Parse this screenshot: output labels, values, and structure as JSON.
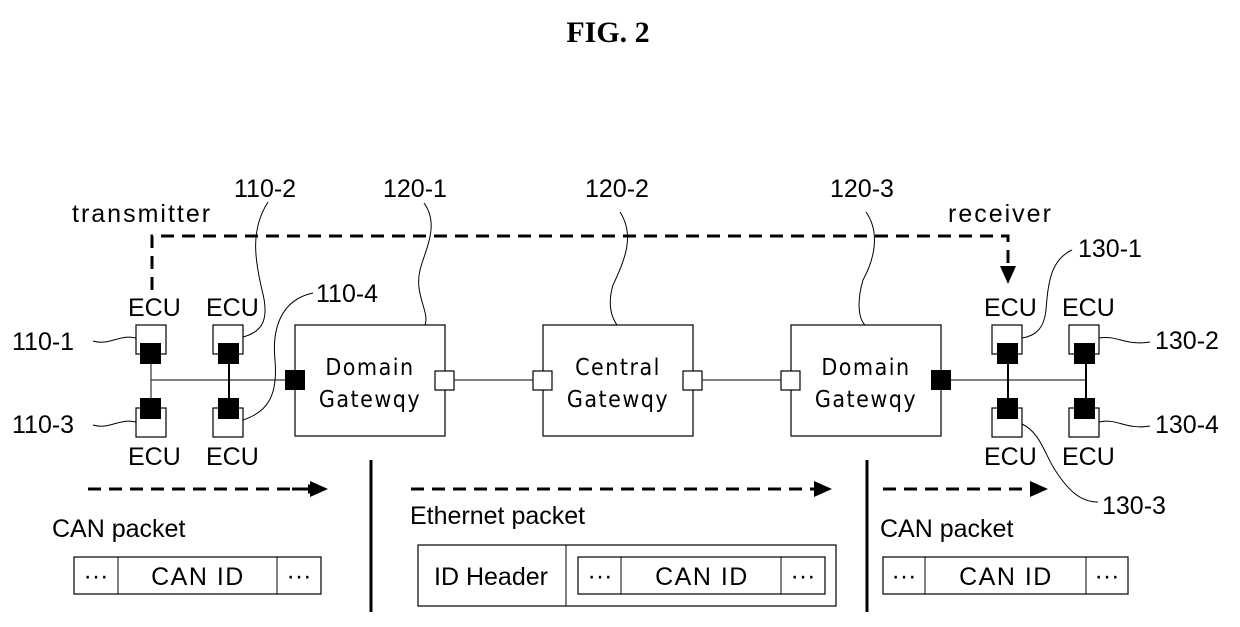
{
  "figure_title": "FIG. 2",
  "roles": {
    "transmitter": "transmitter",
    "receiver": "receiver"
  },
  "ecu_label": "ECU",
  "refs": {
    "r110_1": "110-1",
    "r110_2": "110-2",
    "r110_3": "110-3",
    "r110_4": "110-4",
    "r120_1": "120-1",
    "r120_2": "120-2",
    "r120_3": "120-3",
    "r130_1": "130-1",
    "r130_2": "130-2",
    "r130_3": "130-3",
    "r130_4": "130-4"
  },
  "gateways": [
    {
      "line1": "Domain",
      "line2": "Gatewqy"
    },
    {
      "line1": "Central",
      "line2": "Gatewqy"
    },
    {
      "line1": "Domain",
      "line2": "Gatewqy"
    }
  ],
  "packets": {
    "left": {
      "name": "CAN packet",
      "fields": [
        "···",
        "CAN ID",
        "···"
      ]
    },
    "middle": {
      "name": "Ethernet packet",
      "header": "ID Header",
      "fields": [
        "···",
        "CAN ID",
        "···"
      ]
    },
    "right": {
      "name": "CAN packet",
      "fields": [
        "···",
        "CAN ID",
        "···"
      ]
    }
  }
}
